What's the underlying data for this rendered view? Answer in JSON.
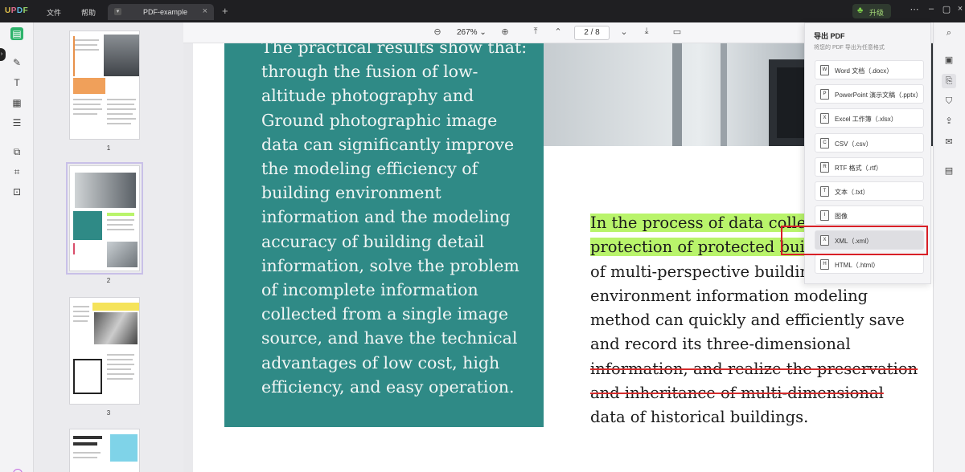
{
  "app": {
    "logo": {
      "u": "U",
      "p": "P",
      "d": "D",
      "f": "F"
    },
    "menu": [
      "文件",
      "帮助"
    ],
    "tab": {
      "label": "PDF-example",
      "icon": "dropdown-icon"
    },
    "upgrade_label": "升级"
  },
  "viewer": {
    "zoom": "267%",
    "page_current": "2",
    "page_total": "8",
    "page_display": "2 / 8"
  },
  "thumbnails": [
    {
      "number": "1"
    },
    {
      "number": "2"
    },
    {
      "number": "3"
    },
    {
      "number": ""
    }
  ],
  "document": {
    "teal_lines": [
      "The practical results show that:",
      "through the fusion of low-",
      "altitude photography and",
      "Ground photographic image",
      "data can significantly improve",
      "the modeling efficiency of",
      "building environment",
      "information and the modeling",
      "accuracy of building detail",
      "information, solve the problem",
      "of incomplete information",
      "collected from a single image",
      "source, and have the technical",
      "advantages of low cost, high",
      "efficiency, and easy operation."
    ],
    "body_lines": [
      {
        "text": "In the process of data collecti",
        "style": "highlight"
      },
      {
        "text": "protection of protected build",
        "style": "highlight"
      },
      {
        "text": "of multi-perspective buildin",
        "style": "normal"
      },
      {
        "text": "environment information modeling",
        "style": "normal"
      },
      {
        "text": "method can quickly and efficiently save",
        "style": "normal"
      },
      {
        "text": "and record its three-dimensional",
        "style": "normal"
      },
      {
        "text": "information, and realize the preservation",
        "style": "strike"
      },
      {
        "text": "and inheritance of multi-dimensional",
        "style": "strike"
      },
      {
        "text": "data of historical buildings.",
        "style": "normal"
      }
    ]
  },
  "export_panel": {
    "title": "导出 PDF",
    "subtitle": "将您的 PDF 导出为任意格式",
    "items": [
      {
        "label": "Word 文档（.docx）",
        "icon": "W"
      },
      {
        "label": "PowerPoint 演示文稿（.pptx）",
        "icon": "P"
      },
      {
        "label": "Excel 工作簿（.xlsx）",
        "icon": "X"
      },
      {
        "label": "CSV（.csv）",
        "icon": "C"
      },
      {
        "label": "RTF 格式（.rtf）",
        "icon": "R"
      },
      {
        "label": "文本（.txt）",
        "icon": "T"
      },
      {
        "label": "图像",
        "icon": "I"
      },
      {
        "label": "XML（.xml）",
        "icon": "X"
      },
      {
        "label": "HTML（.html）",
        "icon": "H"
      }
    ],
    "highlighted_index": 7
  },
  "colors": {
    "accent_green": "#2eb36b",
    "teal_block": "#2f8a86",
    "highlight": "#b9f46b",
    "strike_red": "#d62b2b",
    "annotation_red": "#d81f26"
  }
}
